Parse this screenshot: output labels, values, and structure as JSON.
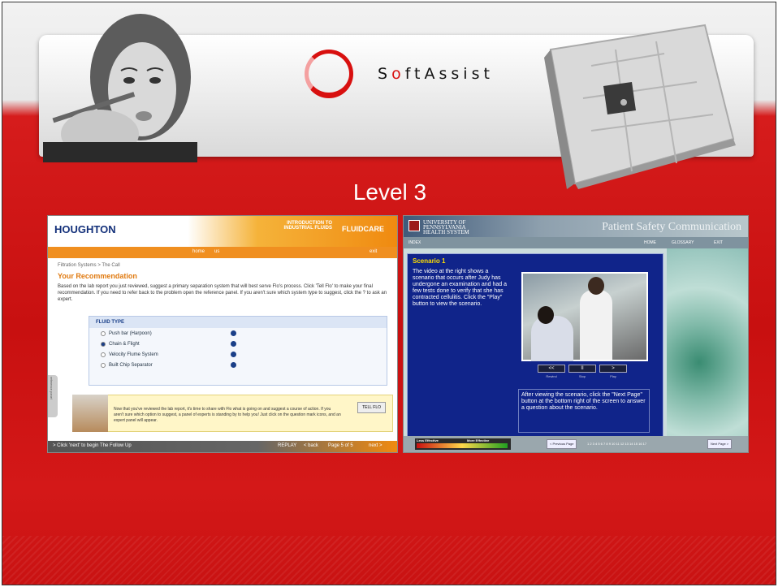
{
  "brand": {
    "name_prefix": "S",
    "name_o": "o",
    "name_rest": "ftAssist"
  },
  "level_title": "Level 3",
  "left_screen": {
    "brand": "HOUGHTON",
    "course": "INTRODUCTION TO INDUSTRIAL FLUIDS",
    "product": "FLUIDCARE",
    "nav": {
      "home": "home",
      "save": "us",
      "exit": "exit"
    },
    "breadcrumb": "Filtration Systems > The Call",
    "heading": "Your Recommendation",
    "paragraph": "Based on the lab report you just reviewed, suggest a primary separation system that will best serve Flo's process. Click 'Tell Flo' to make your final recommendation. If you need to refer back to the problem open the reference panel. If you aren't sure which system type to suggest, click the ? to ask an expert.",
    "fluid_type_label": "FLUID TYPE",
    "options": [
      {
        "label": "Push bar (Harpoon)",
        "selected": false
      },
      {
        "label": "Chain & Flight",
        "selected": true
      },
      {
        "label": "Velocity Flume System",
        "selected": false
      },
      {
        "label": "Built Chip Separator",
        "selected": false
      }
    ],
    "reference_tab": "reference panel",
    "expert_message": "Now that you've reviewed the lab report, it's time to share with Flo what is going on and suggest a course of action. If you aren't sure which option to suggest, a panel of experts is standing by to help you! Just click on the question mark icons, and an expert panel will appear.",
    "tell_button": "TELL FLO",
    "footer": {
      "next_hint": "> Click 'next' to begin The Follow Up",
      "replay": "REPLAY",
      "back": "< back",
      "page": "Page 5 of 5",
      "next": "next >"
    }
  },
  "right_screen": {
    "university": [
      "UNIVERSITY OF",
      "PENNSYLVANIA",
      "HEALTH SYSTEM"
    ],
    "title": "Patient Safety Communication",
    "nav": {
      "index": "INDEX",
      "home": "HOME",
      "glossary": "GLOSSARY",
      "exit": "EXIT"
    },
    "scenario_title": "Scenario 1",
    "scenario_text": "The video at the right shows a scenario that occurs after Judy has undergone an examination and had a few tests done to verify that she has contracted cellulitis. Click the \"Play\" button to view the scenario.",
    "controls": [
      {
        "icon": "<<",
        "label": "Rewind"
      },
      {
        "icon": "II",
        "label": "Stop"
      },
      {
        "icon": ">",
        "label": "Play"
      }
    ],
    "after_text": "After viewing the scenario, click the \"Next Page\" button at the bottom right of the screen to answer a question about the scenario.",
    "meter": {
      "less": "Less Effective",
      "more": "More Effective"
    },
    "prev_page": "< Previous Page",
    "pages": "1   2   3   4   5   6   7   8   9   10   11   12   13   14   15   16   17",
    "next_page": "Next Page >"
  }
}
